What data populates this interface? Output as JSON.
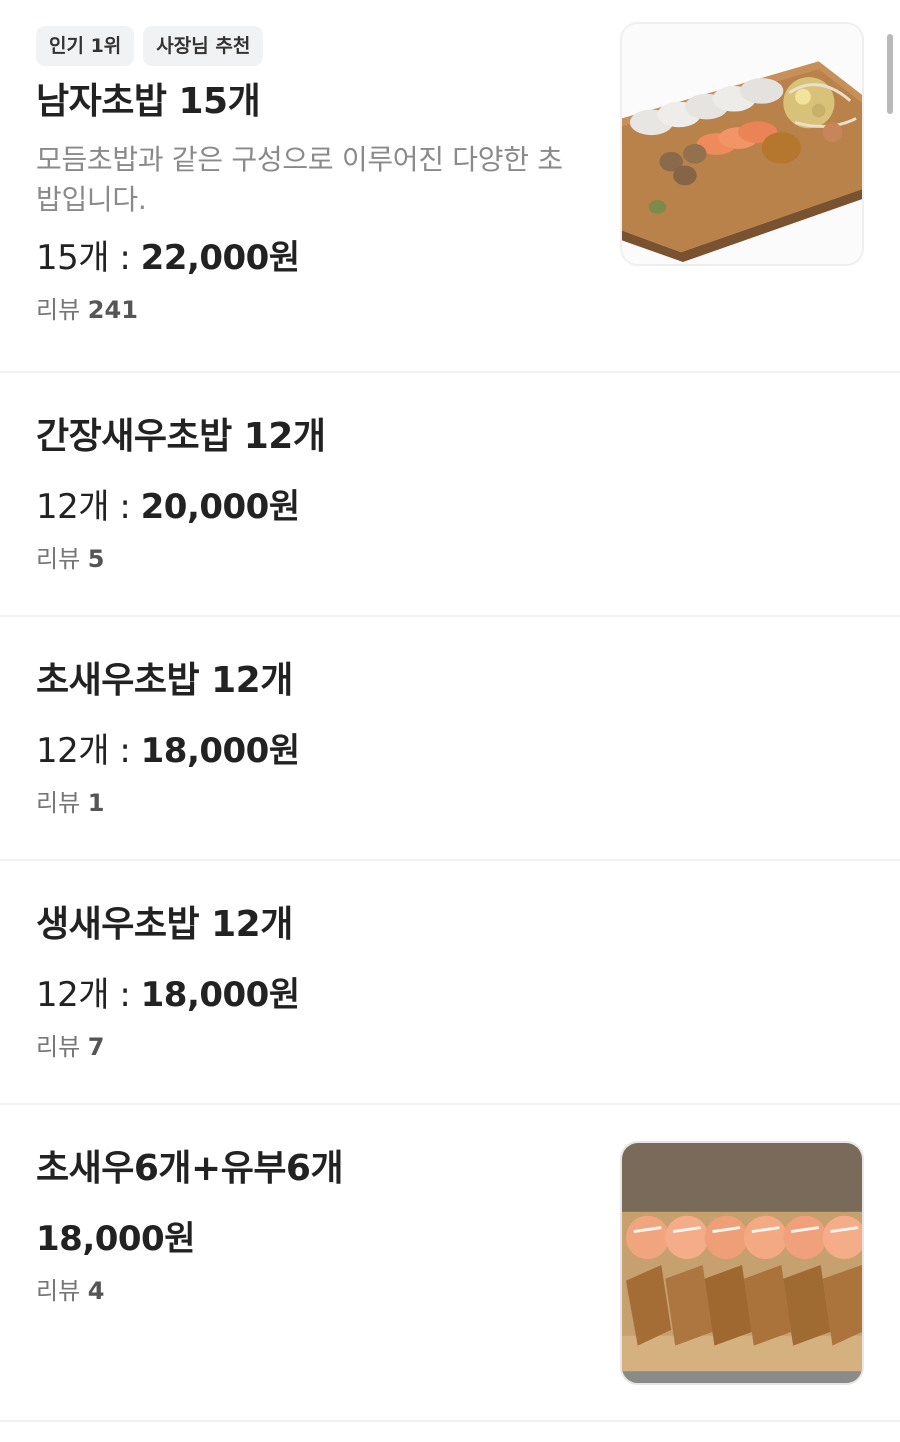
{
  "menu": {
    "items": [
      {
        "badges": [
          "인기 1위",
          "사장님 추천"
        ],
        "name": "남자초밥 15개",
        "description": "모듬초밥과 같은 구성으로 이루어진 다양한 초밥입니다.",
        "price_qty": "15개 : ",
        "price_amount": "22,000원",
        "review_label": "리뷰 ",
        "review_count": "241",
        "image": "mixed-sushi-platter-photo"
      },
      {
        "name": "간장새우초밥 12개",
        "price_qty": "12개 : ",
        "price_amount": "20,000원",
        "review_label": "리뷰 ",
        "review_count": "5"
      },
      {
        "name": "초새우초밥 12개",
        "price_qty": "12개 : ",
        "price_amount": "18,000원",
        "review_label": "리뷰 ",
        "review_count": "1"
      },
      {
        "name": "생새우초밥 12개",
        "price_qty": "12개 : ",
        "price_amount": "18,000원",
        "review_label": "리뷰 ",
        "review_count": "7"
      },
      {
        "name": "초새우6개+유부6개",
        "price_amount": "18,000원",
        "review_label": "리뷰 ",
        "review_count": "4",
        "image": "shrimp-and-inari-sushi-photo"
      }
    ]
  },
  "colors": {
    "text_primary": "#222222",
    "text_secondary": "#8a8a8a",
    "badge_bg": "#f1f2f4",
    "divider": "#f1f1f1"
  }
}
